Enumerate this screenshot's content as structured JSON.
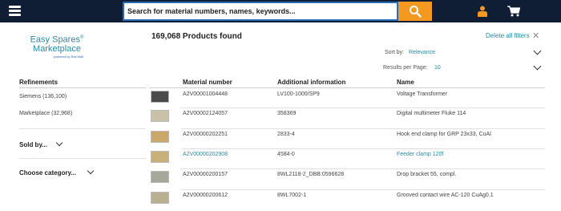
{
  "header": {
    "search_placeholder": "Search for material numbers, names, keywords...",
    "menu_icon": "hamburger-menu-icon",
    "search_icon": "magnifier-icon",
    "user_icon": "user-icon",
    "cart_icon": "shopping-cart-icon",
    "accent_color": "#f5981f",
    "bar_color": "#0f1d35"
  },
  "logo": {
    "line1": "Easy Spares",
    "registered": "®",
    "line2": "Marketplace",
    "sub": "powered by Rail Mall"
  },
  "results": {
    "count_text": "169,068 Products found",
    "delete_filters": "Delete all filters",
    "sort_label": "Sort by:",
    "sort_value": "Relevance",
    "rpp_label": "Results per Page:",
    "rpp_value": "10"
  },
  "sidebar": {
    "title": "Refinements",
    "facets": [
      "Siemens (136,100)",
      "Marketplace (32,968)"
    ],
    "sold_by": "Sold by...",
    "category": "Choose category..."
  },
  "table": {
    "columns": [
      "Material number",
      "Additional information",
      "Name"
    ],
    "rows": [
      {
        "material": "A2V00001004448",
        "info": "LV100-1000/SP9",
        "name": "Voltage Transformer",
        "thumb_color": "#4a4a4a",
        "name_link": false,
        "material_link": false
      },
      {
        "material": "A2V00002124057",
        "info": "358369",
        "name": "Digital multimeter Fluke 114",
        "thumb_color": "#c9c2a8",
        "name_link": false,
        "material_link": false
      },
      {
        "material": "A2V00000202251",
        "info": "2833-4",
        "name": "Hook end clamp for GRP 23x33, CuAl",
        "thumb_color": "#c9a86a",
        "name_link": false,
        "material_link": false
      },
      {
        "material": "A2V00000202908",
        "info": "4584-0",
        "name": "Feeder clamp 120f",
        "thumb_color": "#c9b07a",
        "name_link": true,
        "material_link": true
      },
      {
        "material": "A2V00000200157",
        "info": "8WL2118-2_DBB:0596628",
        "name": "Drop bracket 55, compl.",
        "thumb_color": "#a8a89a",
        "name_link": false,
        "material_link": false
      },
      {
        "material": "A2V00000200612",
        "info": "8WL7002-1",
        "name": "Grooved contact wire AC-120 CuAg0.1",
        "thumb_color": "#b8b090",
        "name_link": false,
        "material_link": false
      }
    ]
  }
}
